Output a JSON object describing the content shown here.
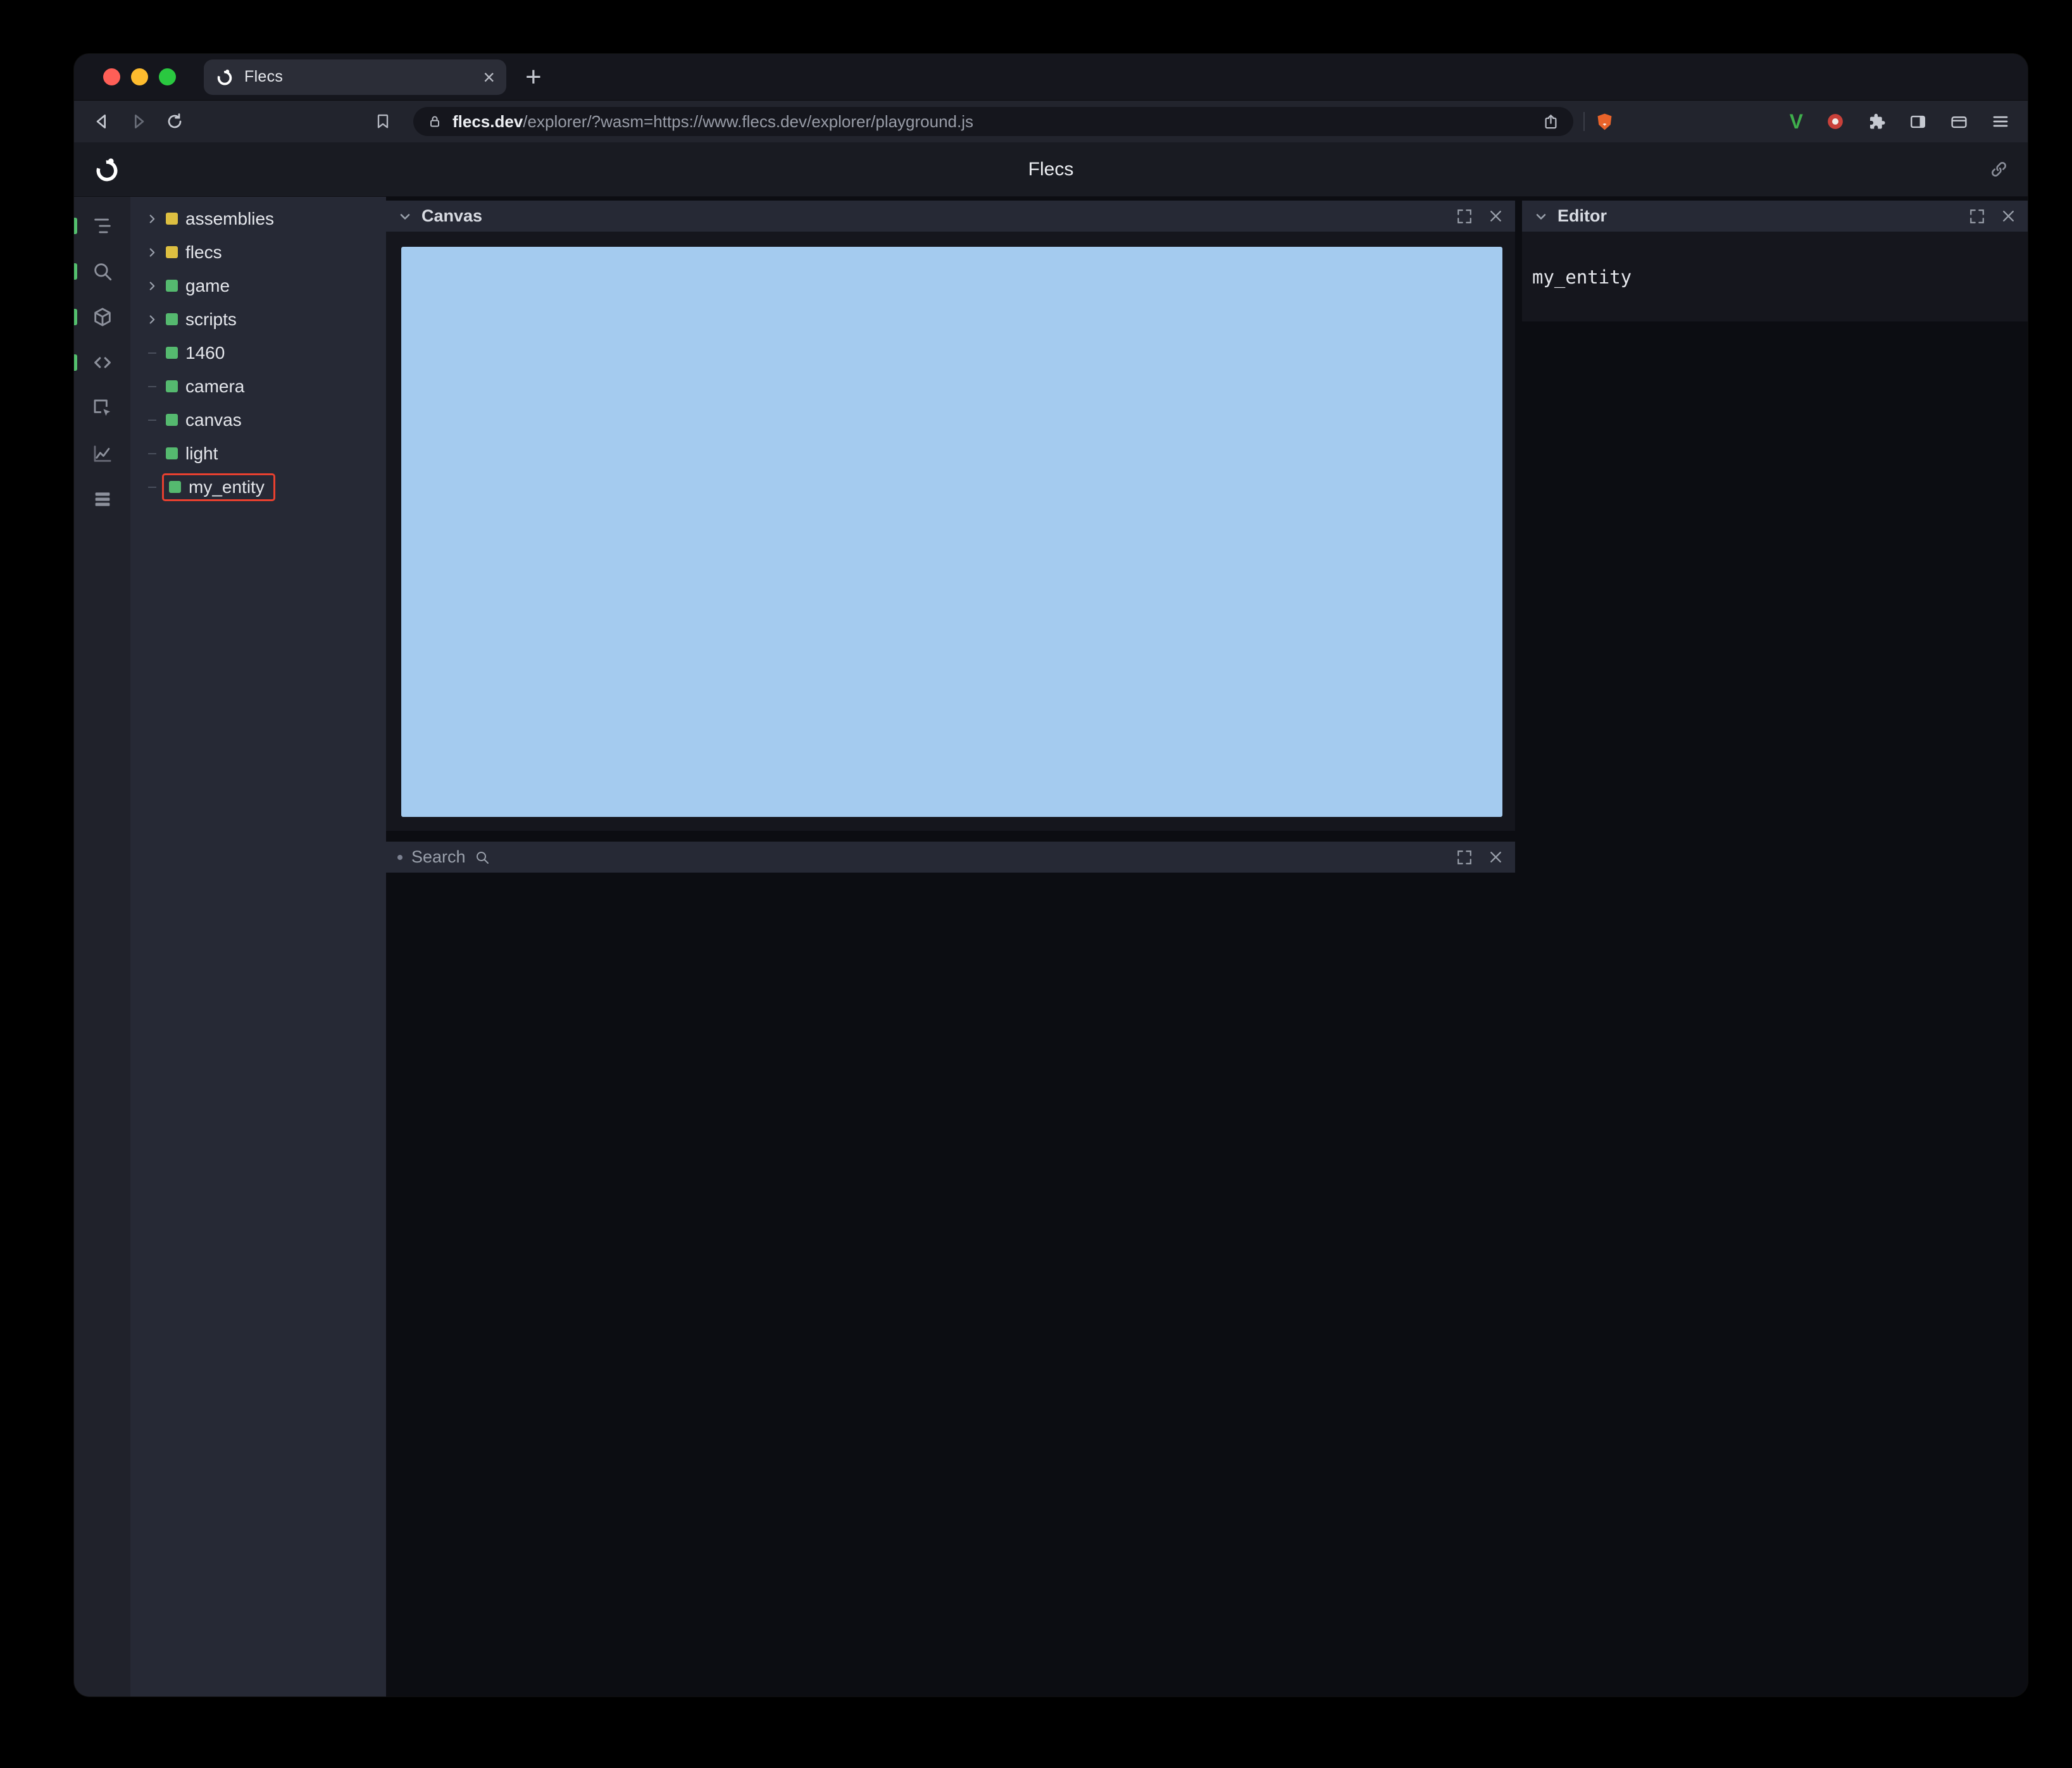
{
  "icons": {
    "close": "×",
    "plus": "+",
    "v_ext": "V"
  },
  "browser": {
    "tab": {
      "title": "Flecs"
    },
    "url": {
      "domain": "flecs.dev",
      "path": "/explorer/?wasm=https://www.flecs.dev/explorer/playground.js"
    }
  },
  "app": {
    "header": {
      "title": "Flecs"
    },
    "tree": {
      "items": [
        {
          "label": "assemblies"
        },
        {
          "label": "flecs"
        },
        {
          "label": "game"
        },
        {
          "label": "scripts"
        },
        {
          "label": "1460"
        },
        {
          "label": "camera"
        },
        {
          "label": "canvas"
        },
        {
          "label": "light"
        },
        {
          "label": "my_entity"
        }
      ]
    },
    "panels": {
      "canvas": {
        "title": "Canvas"
      },
      "search": {
        "label": "Search"
      },
      "editor": {
        "title": "Editor",
        "content": "my_entity"
      }
    },
    "colors": {
      "canvas_blue": "#a4cbef",
      "green_square": "#55b96f",
      "yellow_square": "#ddbf41",
      "highlight_red": "#e8402f",
      "indicator_green": "#54c06e"
    }
  }
}
